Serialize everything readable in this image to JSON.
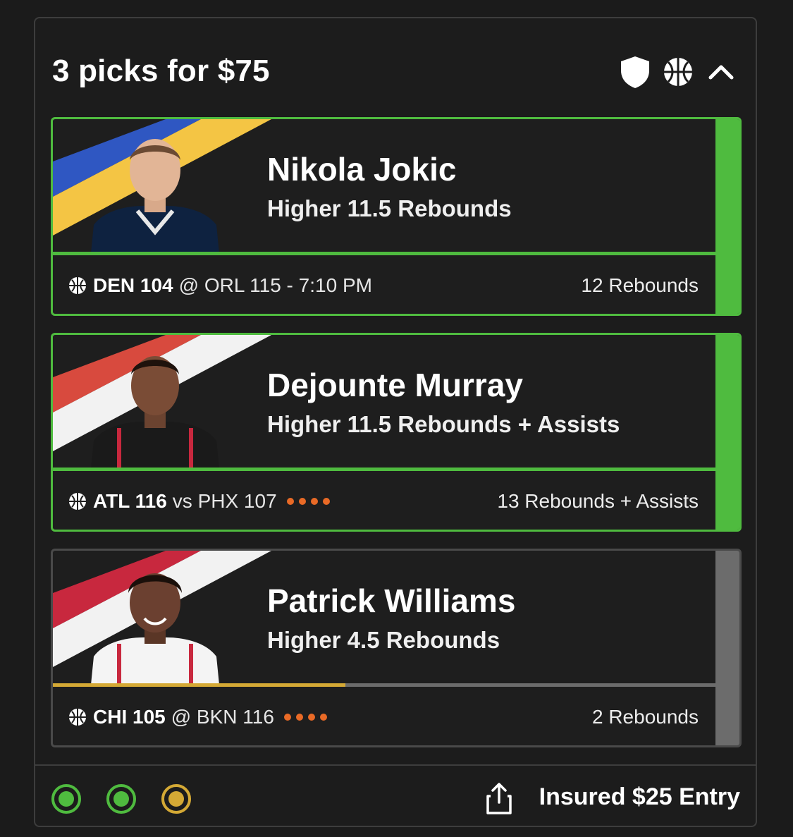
{
  "entry": {
    "title": "3 picks for $75",
    "footer_label": "Insured $25 Entry",
    "status_circles": [
      "#4fbb3f",
      "#4fbb3f",
      "#d4a935"
    ]
  },
  "icons": {
    "header": [
      "shield-icon",
      "basketball-icon",
      "chevron-up-icon"
    ],
    "footer": [
      "share-icon"
    ]
  },
  "picks": [
    {
      "player": "Nikola Jokic",
      "line": "Higher 11.5 Rebounds",
      "team_score": "DEN 104",
      "matchup": "@ ORL 115 - 7:10 PM",
      "result": "12 Rebounds",
      "status": "hit",
      "team_colors": [
        "#2f57c2",
        "#f4c544"
      ],
      "jersey_color": "#0e2240"
    },
    {
      "player": "Dejounte Murray",
      "line": "Higher 11.5 Rebounds + Assists",
      "team_score": "ATL 116",
      "matchup": "vs PHX 107",
      "result": "13 Rebounds + Assists",
      "status": "hit",
      "team_colors": [
        "#d84a3e",
        "#f2f2f2"
      ],
      "jersey_color": "#1a1a1a"
    },
    {
      "player": "Patrick Williams",
      "line": "Higher 4.5 Rebounds",
      "team_score": "CHI 105",
      "matchup": "@ BKN 116",
      "result": "2 Rebounds",
      "status": "pending",
      "progress": 0.44,
      "team_colors": [
        "#c8283e",
        "#f2f2f2"
      ],
      "jersey_color": "#f4f4f4"
    }
  ]
}
